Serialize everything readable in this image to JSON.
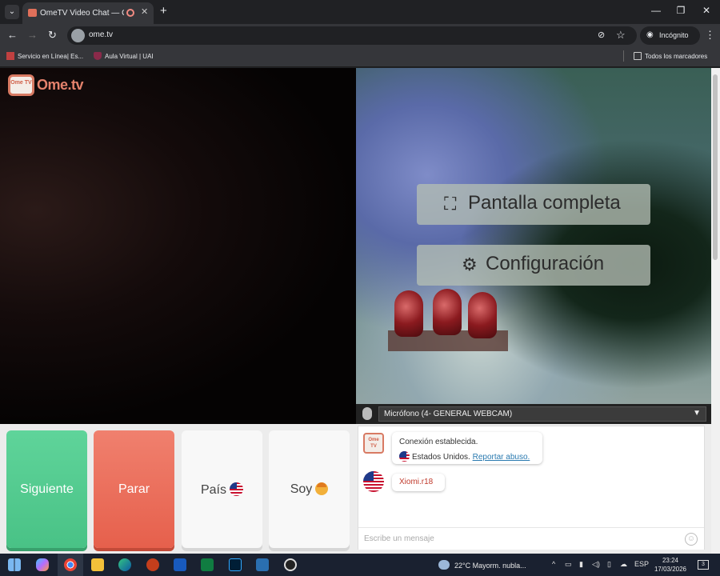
{
  "browser": {
    "tab_title": "OmeTV Video Chat — Ome",
    "tab_close": "✕",
    "new_tab": "+",
    "url": "ome.tv",
    "incognito_label": "Incógnito",
    "window_controls": {
      "minimize": "—",
      "maximize": "❐",
      "close": "✕"
    },
    "bookmarks": [
      "Servicio en Línea| Es...",
      "Aula Virtual | UAI"
    ],
    "all_bookmarks": "Todos los marcadores"
  },
  "logo": {
    "badge": "Ome TV",
    "text": "Ome.tv"
  },
  "overlay": {
    "fullscreen_label": "Pantalla completa",
    "settings_label": "Configuración"
  },
  "mic": {
    "selected": "Micrófono (4- GENERAL WEBCAM)"
  },
  "controls": {
    "next_label": "Siguiente",
    "stop_label": "Parar",
    "country_label": "País",
    "gender_label": "Soy"
  },
  "chat": {
    "system_line1": "Conexión establecida.",
    "system_country": "Estados Unidos.",
    "report_link": "Reportar abuso.",
    "user_message": "Xiomi.r18",
    "input_placeholder": "Escribe un mensaje"
  },
  "taskbar": {
    "weather": "22°C  Mayorm. nubla...",
    "language": "ESP",
    "time": "23:24",
    "date": "17/03/2026",
    "notification_count": "3"
  },
  "colors": {
    "next": "#4fc98c",
    "stop": "#ea6b57",
    "accent_logo": "#e4826c",
    "link": "#2a7ab0"
  }
}
